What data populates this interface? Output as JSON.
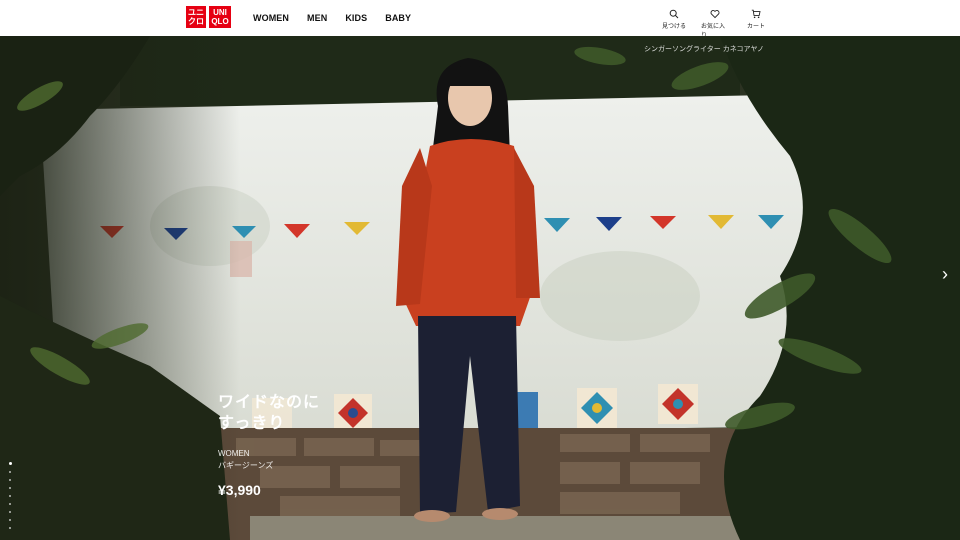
{
  "brand": {
    "logo_jp": "ユニ\nクロ",
    "logo_en": "UNI\nQLO"
  },
  "nav": {
    "items": [
      "WOMEN",
      "MEN",
      "KIDS",
      "BABY"
    ]
  },
  "utils": [
    {
      "label": "見つける",
      "icon": "search-icon"
    },
    {
      "label": "お気に入り",
      "icon": "heart-icon"
    },
    {
      "label": "カート",
      "icon": "cart-icon"
    }
  ],
  "hero": {
    "credit": "シンガーソングライター カネコアヤノ",
    "headline_line1": "ワイドなのに",
    "headline_line2": "すっきり",
    "category": "WOMEN",
    "product": "バギージーンズ",
    "price": "¥3,990",
    "slide_count": 9,
    "active_slide": 0
  },
  "colors": {
    "brand_red": "#e60012",
    "header_bg": "#ffffff",
    "text": "#111111"
  }
}
